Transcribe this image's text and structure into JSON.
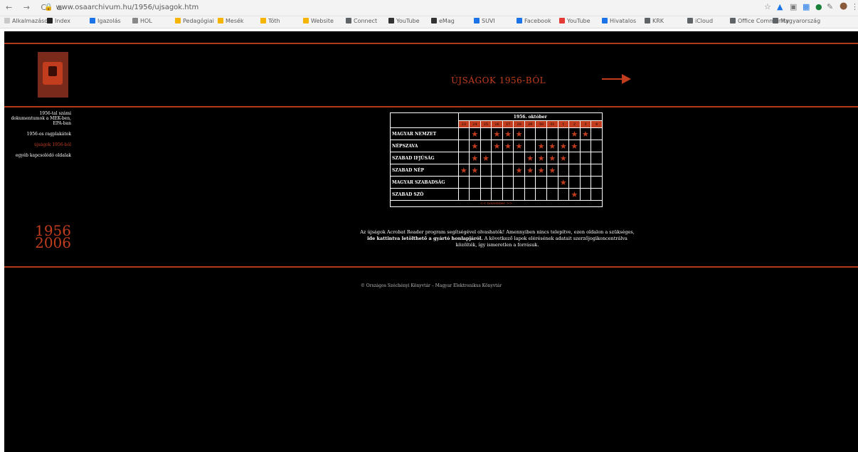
{
  "browser": {
    "nav_glyphs": "← → C ⌂",
    "url": "www.osaarchivum.hu/1956/ujsagok.htm",
    "bookmarks": [
      "Alkalmazások",
      "Index",
      "Igazolás",
      "HOL",
      "Pedagógiai",
      "Mesék",
      "Tóth",
      "Website",
      "Connect",
      "YouTube",
      "eMag",
      "SUVI",
      "Facebook",
      "YouTube",
      "Hivatalos",
      "KRK",
      "iCloud",
      "Office Community",
      "Magyarország"
    ]
  },
  "header": {
    "title": "ÚJSÁGOK 1956-BÓL"
  },
  "sidebar": {
    "links": [
      {
        "label": "1956-tal számi dokumentumok a MEK-ben, EPA-ban",
        "active": false
      },
      {
        "label": "1956-os ragplakátok",
        "active": false
      },
      {
        "label": "újságok 1956-ból",
        "active": true
      },
      {
        "label": "egyéb kapcsolódó oldalak",
        "active": false
      }
    ],
    "year_top": "1956",
    "year_bottom": "2006"
  },
  "table": {
    "caption": "1956. október",
    "days": [
      "23",
      "24",
      "25",
      "26",
      "27",
      "28",
      "29",
      "30",
      "31",
      "1",
      "2",
      "3",
      "4"
    ],
    "rows": [
      {
        "name": "MAGYAR NEMZET",
        "stars": [
          false,
          true,
          false,
          true,
          true,
          true,
          false,
          false,
          false,
          false,
          true,
          true,
          false
        ]
      },
      {
        "name": "NÉPSZAVA",
        "stars": [
          false,
          true,
          false,
          true,
          true,
          true,
          false,
          true,
          true,
          true,
          true,
          false,
          false
        ]
      },
      {
        "name": "SZABAD IFJÚSÁG",
        "stars": [
          false,
          true,
          true,
          false,
          false,
          false,
          true,
          true,
          true,
          true,
          false,
          false,
          false
        ]
      },
      {
        "name": "SZABAD NÉP",
        "stars": [
          true,
          true,
          false,
          false,
          false,
          true,
          true,
          true,
          true,
          false,
          false,
          false,
          false
        ]
      },
      {
        "name": "MAGYAR SZABADSÁG",
        "stars": [
          false,
          false,
          false,
          false,
          false,
          false,
          false,
          false,
          false,
          true,
          false,
          false,
          false
        ]
      },
      {
        "name": "SZABAD SZÓ",
        "stars": [
          false,
          false,
          false,
          false,
          false,
          false,
          false,
          false,
          false,
          false,
          true,
          false,
          false
        ]
      }
    ],
    "nav_text": "<< november >>"
  },
  "note": {
    "part1": "Az újságok Acrobat Reader program segítségével olvashatók! Amennyiben nincs telepítve, ezen oldalon a szükséges,",
    "bold": "ide kattintva letölthető a gyártó honlapjáról.",
    "part2": "A következő lapok elérésének adatait szerzőjogikoncentrálva közölték, így ismeretlen a forrásuk."
  },
  "footer": {
    "text": "© Országos Széchényi Könyvtár – Magyar Elektronikus Könyvtár"
  },
  "colors": {
    "accent": "#c23d1e",
    "background": "#000000"
  }
}
